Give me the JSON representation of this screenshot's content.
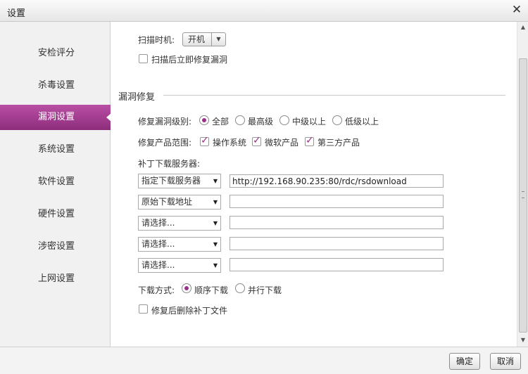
{
  "window": {
    "title": "设置"
  },
  "sidebar": {
    "items": [
      {
        "label": "安检评分"
      },
      {
        "label": "杀毒设置"
      },
      {
        "label": "漏洞设置"
      },
      {
        "label": "系统设置"
      },
      {
        "label": "软件设置"
      },
      {
        "label": "硬件设置"
      },
      {
        "label": "涉密设置"
      },
      {
        "label": "上网设置"
      }
    ],
    "active_index": 2
  },
  "scan": {
    "timing_label": "扫描时机:",
    "timing_value": "开机",
    "fix_after_scan_label": "扫描后立即修复漏洞",
    "fix_after_scan_checked": false
  },
  "repair": {
    "section_title": "漏洞修复",
    "level_label": "修复漏洞级别:",
    "levels": [
      {
        "label": "全部",
        "checked": true
      },
      {
        "label": "最高级",
        "checked": false
      },
      {
        "label": "中级以上",
        "checked": false
      },
      {
        "label": "低级以上",
        "checked": false
      }
    ],
    "scope_label": "修复产品范围:",
    "scopes": [
      {
        "label": "操作系统",
        "checked": true
      },
      {
        "label": "微软产品",
        "checked": true
      },
      {
        "label": "第三方产品",
        "checked": true
      }
    ],
    "server_label": "补丁下载服务器:",
    "servers": [
      {
        "option": "指定下载服务器",
        "url": "http://192.168.90.235:80/rdc/rsdownload"
      },
      {
        "option": "原始下载地址",
        "url": ""
      },
      {
        "option": "请选择...",
        "url": ""
      },
      {
        "option": "请选择...",
        "url": ""
      },
      {
        "option": "请选择...",
        "url": ""
      }
    ],
    "download_mode_label": "下载方式:",
    "download_modes": [
      {
        "label": "顺序下载",
        "checked": true
      },
      {
        "label": "并行下载",
        "checked": false
      }
    ],
    "delete_after_label": "修复后删除补丁文件",
    "delete_after_checked": false
  },
  "footer": {
    "ok_label": "确定",
    "cancel_label": "取消"
  },
  "colors": {
    "accent": "#9b2e86",
    "sidebar_active_top": "#b94fa5",
    "sidebar_active_bottom": "#8e2d7c"
  }
}
